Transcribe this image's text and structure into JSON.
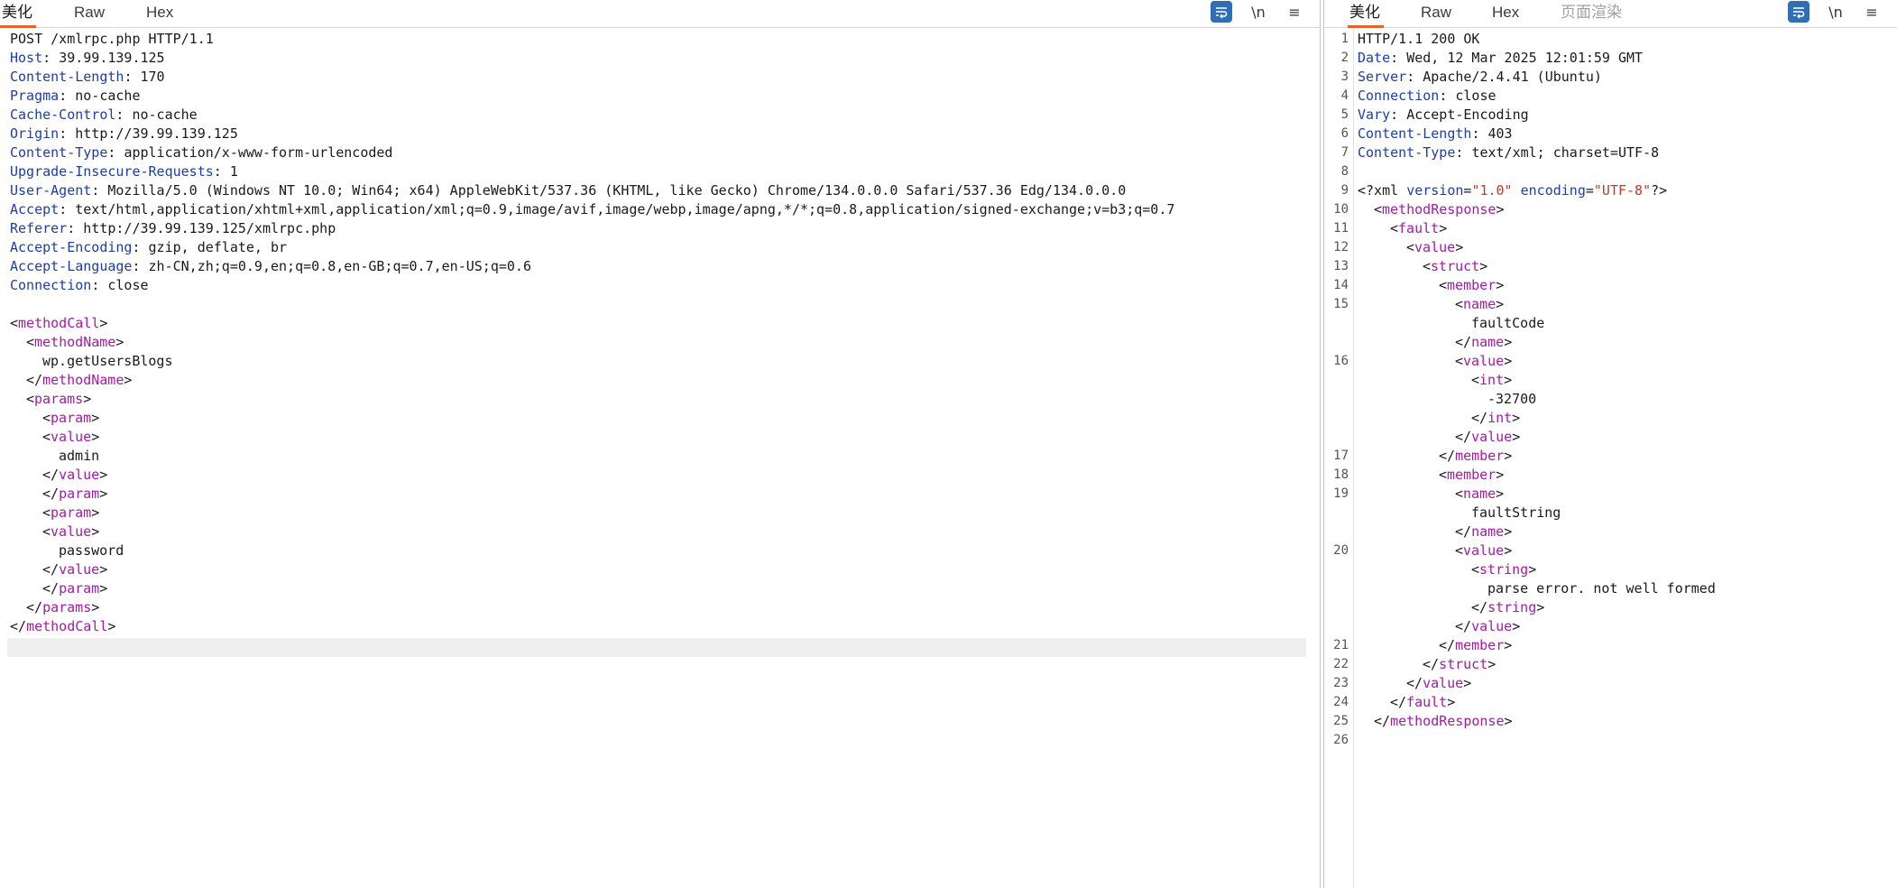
{
  "request_tabs": [
    "美化",
    "Raw",
    "Hex"
  ],
  "response_tabs": [
    "美化",
    "Raw",
    "Hex",
    "页面渲染"
  ],
  "toolbar": {
    "wrap_icon": "wrap-icon",
    "newline_label": "\\n",
    "menu_label": "≡"
  },
  "colors": {
    "accent_tab": "#e8632b",
    "header_key": "#1d3ea8",
    "xml_tag": "#a31ca3",
    "xml_string": "#c0392b",
    "wrap_button": "#2f6fb3"
  },
  "request": {
    "request_line": "POST /xmlrpc.php HTTP/1.1",
    "headers": [
      {
        "key": "Host",
        "value": "39.99.139.125"
      },
      {
        "key": "Content-Length",
        "value": "170"
      },
      {
        "key": "Pragma",
        "value": "no-cache"
      },
      {
        "key": "Cache-Control",
        "value": "no-cache"
      },
      {
        "key": "Origin",
        "value": "http://39.99.139.125"
      },
      {
        "key": "Content-Type",
        "value": "application/x-www-form-urlencoded"
      },
      {
        "key": "Upgrade-Insecure-Requests",
        "value": "1"
      },
      {
        "key": "User-Agent",
        "value": "Mozilla/5.0 (Windows NT 10.0; Win64; x64) AppleWebKit/537.36 (KHTML, like Gecko) Chrome/134.0.0.0 Safari/537.36 Edg/134.0.0.0"
      },
      {
        "key": "Accept",
        "value": "text/html,application/xhtml+xml,application/xml;q=0.9,image/avif,image/webp,image/apng,*/*;q=0.8,application/signed-exchange;v=b3;q=0.7"
      },
      {
        "key": "Referer",
        "value": "http://39.99.139.125/xmlrpc.php"
      },
      {
        "key": "Accept-Encoding",
        "value": "gzip, deflate, br"
      },
      {
        "key": "Accept-Language",
        "value": "zh-CN,zh;q=0.9,en;q=0.8,en-GB;q=0.7,en-US;q=0.6"
      },
      {
        "key": "Connection",
        "value": "close"
      }
    ],
    "body_lines": [
      {
        "indent": 0,
        "kind": "open",
        "tag": "methodCall"
      },
      {
        "indent": 1,
        "kind": "open",
        "tag": "methodName"
      },
      {
        "indent": 2,
        "kind": "text",
        "text": "wp.getUsersBlogs"
      },
      {
        "indent": 1,
        "kind": "close",
        "tag": "methodName"
      },
      {
        "indent": 1,
        "kind": "open",
        "tag": "params"
      },
      {
        "indent": 2,
        "kind": "open",
        "tag": "param"
      },
      {
        "indent": 2,
        "kind": "open",
        "tag": "value"
      },
      {
        "indent": 3,
        "kind": "text",
        "text": "admin"
      },
      {
        "indent": 2,
        "kind": "close",
        "tag": "value"
      },
      {
        "indent": 2,
        "kind": "close",
        "tag": "param"
      },
      {
        "indent": 2,
        "kind": "open",
        "tag": "param"
      },
      {
        "indent": 2,
        "kind": "open",
        "tag": "value"
      },
      {
        "indent": 3,
        "kind": "text",
        "text": "password"
      },
      {
        "indent": 2,
        "kind": "close",
        "tag": "value"
      },
      {
        "indent": 2,
        "kind": "close",
        "tag": "param"
      },
      {
        "indent": 1,
        "kind": "close",
        "tag": "params"
      },
      {
        "indent": 0,
        "kind": "close",
        "tag": "methodCall"
      }
    ]
  },
  "response": {
    "status_line": "HTTP/1.1 200 OK",
    "headers": [
      {
        "key": "Date",
        "value": "Wed, 12 Mar 2025 12:01:59 GMT"
      },
      {
        "key": "Server",
        "value": "Apache/2.4.41 (Ubuntu)"
      },
      {
        "key": "Connection",
        "value": "close"
      },
      {
        "key": "Vary",
        "value": "Accept-Encoding"
      },
      {
        "key": "Content-Length",
        "value": "403"
      },
      {
        "key": "Content-Type",
        "value": "text/xml; charset=UTF-8"
      }
    ],
    "xml_decl": {
      "open": "<?xml",
      "attr1": "version",
      "val1": "\"1.0\"",
      "attr2": "encoding",
      "val2": "\"UTF-8\"",
      "close": "?>"
    },
    "body_lines": [
      {
        "num": "10",
        "indent": 1,
        "kind": "open",
        "tag": "methodResponse"
      },
      {
        "num": "11",
        "indent": 2,
        "kind": "open",
        "tag": "fault"
      },
      {
        "num": "12",
        "indent": 3,
        "kind": "open",
        "tag": "value"
      },
      {
        "num": "13",
        "indent": 4,
        "kind": "open",
        "tag": "struct"
      },
      {
        "num": "14",
        "indent": 5,
        "kind": "open",
        "tag": "member"
      },
      {
        "num": "15",
        "indent": 6,
        "kind": "open",
        "tag": "name"
      },
      {
        "num": "",
        "indent": 7,
        "kind": "text",
        "text": "faultCode"
      },
      {
        "num": "",
        "indent": 6,
        "kind": "close",
        "tag": "name"
      },
      {
        "num": "16",
        "indent": 6,
        "kind": "open",
        "tag": "value"
      },
      {
        "num": "",
        "indent": 7,
        "kind": "open",
        "tag": "int"
      },
      {
        "num": "",
        "indent": 8,
        "kind": "text",
        "text": "-32700"
      },
      {
        "num": "",
        "indent": 7,
        "kind": "close",
        "tag": "int"
      },
      {
        "num": "",
        "indent": 6,
        "kind": "close",
        "tag": "value"
      },
      {
        "num": "17",
        "indent": 5,
        "kind": "close",
        "tag": "member"
      },
      {
        "num": "18",
        "indent": 5,
        "kind": "open",
        "tag": "member"
      },
      {
        "num": "19",
        "indent": 6,
        "kind": "open",
        "tag": "name"
      },
      {
        "num": "",
        "indent": 7,
        "kind": "text",
        "text": "faultString"
      },
      {
        "num": "",
        "indent": 6,
        "kind": "close",
        "tag": "name"
      },
      {
        "num": "20",
        "indent": 6,
        "kind": "open",
        "tag": "value"
      },
      {
        "num": "",
        "indent": 7,
        "kind": "open",
        "tag": "string"
      },
      {
        "num": "",
        "indent": 8,
        "kind": "text",
        "text": "parse error. not well formed"
      },
      {
        "num": "",
        "indent": 7,
        "kind": "close",
        "tag": "string"
      },
      {
        "num": "",
        "indent": 6,
        "kind": "close",
        "tag": "value"
      },
      {
        "num": "21",
        "indent": 5,
        "kind": "close",
        "tag": "member"
      },
      {
        "num": "22",
        "indent": 4,
        "kind": "close",
        "tag": "struct"
      },
      {
        "num": "23",
        "indent": 3,
        "kind": "close",
        "tag": "value"
      },
      {
        "num": "24",
        "indent": 2,
        "kind": "close",
        "tag": "fault"
      },
      {
        "num": "25",
        "indent": 1,
        "kind": "close",
        "tag": "methodResponse"
      },
      {
        "num": "26",
        "indent": 0,
        "kind": "empty"
      }
    ]
  }
}
